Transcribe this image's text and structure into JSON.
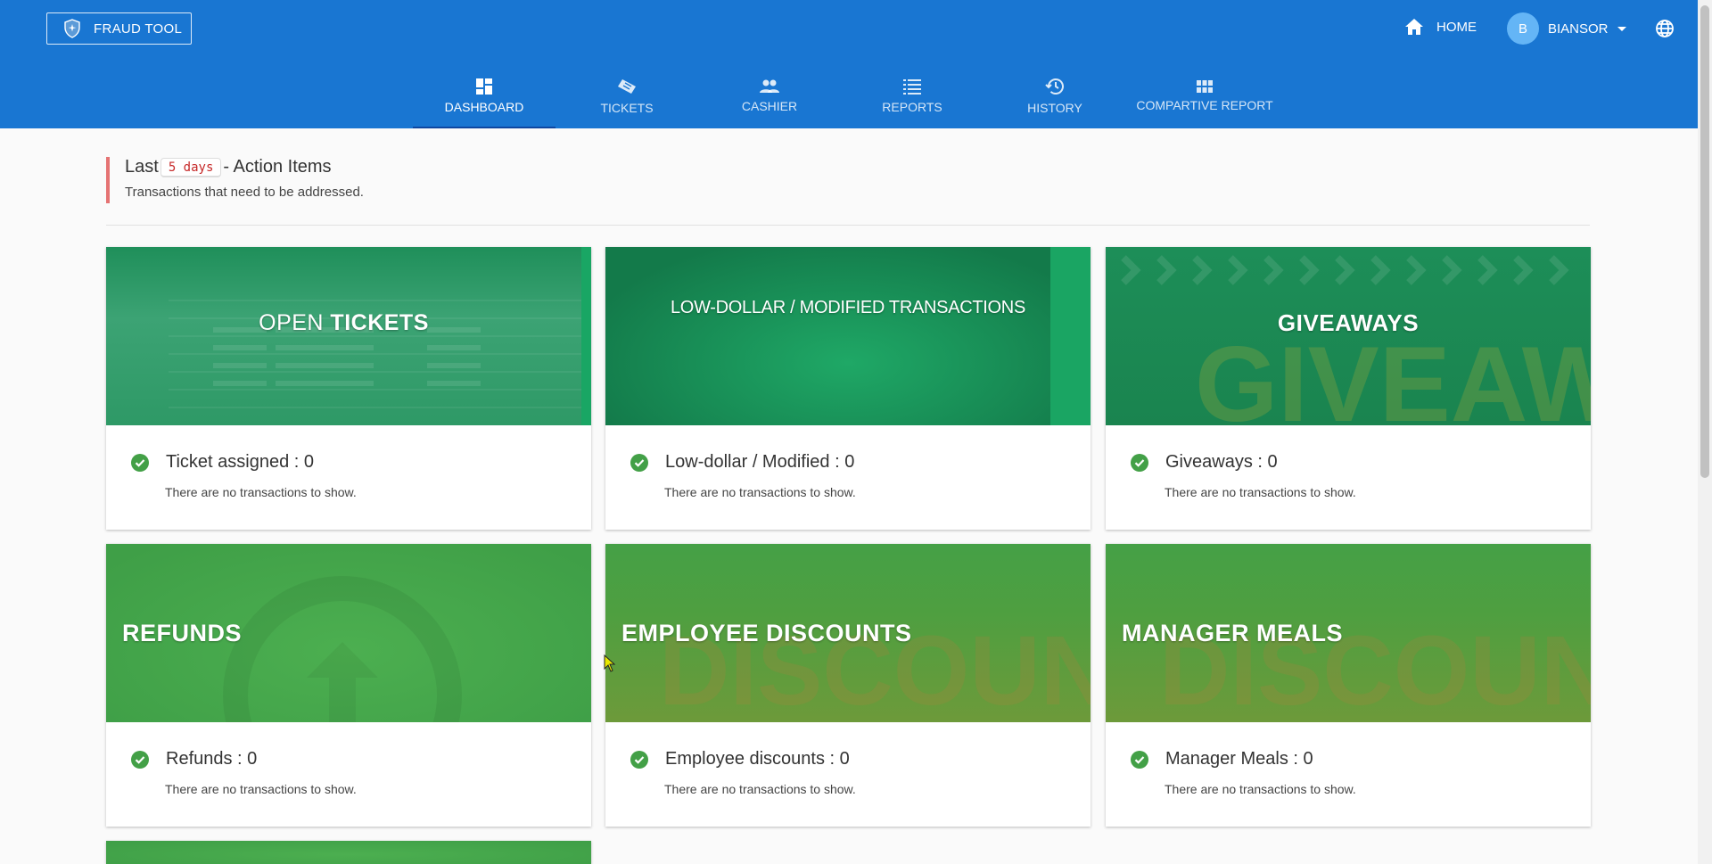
{
  "app": {
    "brand_label": "FRAUD TOOL",
    "home_label": "HOME",
    "user": {
      "initial": "B",
      "name": "BIANSOR"
    }
  },
  "nav": {
    "tabs": [
      {
        "label": "DASHBOARD",
        "icon": "dashboard-icon",
        "active": true
      },
      {
        "label": "TICKETS",
        "icon": "ticket-icon"
      },
      {
        "label": "CASHIER",
        "icon": "people-icon"
      },
      {
        "label": "REPORTS",
        "icon": "list-icon"
      },
      {
        "label": "HISTORY",
        "icon": "history-icon"
      },
      {
        "label": "COMPARTIVE REPORT",
        "icon": "grid-icon"
      }
    ]
  },
  "section": {
    "title_prefix": "Last",
    "days": "5 days",
    "title_suffix": "- Action Items",
    "subtitle": "Transactions that need to be addressed."
  },
  "cards": [
    {
      "banner_light": "OPEN ",
      "banner_bold": "TICKETS",
      "status": "Ticket assigned : 0",
      "note": "There are no transactions to show."
    },
    {
      "banner": "LOW-DOLLAR / MODIFIED TRANSACTIONS",
      "status": "Low-dollar / Modified : 0",
      "note": "There are no transactions to show."
    },
    {
      "banner": "GIVEAWAYS",
      "banner_watermark": "GIVEAWAY!",
      "status": "Giveaways : 0",
      "note": "There are no transactions to show."
    },
    {
      "banner": "REFUNDS",
      "status": "Refunds : 0",
      "note": "There are no transactions to show."
    },
    {
      "banner": "EMPLOYEE DISCOUNTS",
      "banner_watermark": "DISCOUNT",
      "status": "Employee discounts : 0",
      "note": "There are no transactions to show."
    },
    {
      "banner": "MANAGER MEALS",
      "banner_watermark": "DISCOUNT",
      "status": "Manager Meals : 0",
      "note": "There are no transactions to show."
    }
  ],
  "colors": {
    "primary": "#1976d2",
    "accent_bar": "#e57373",
    "success": "#43a047",
    "days_text": "#c62828"
  }
}
